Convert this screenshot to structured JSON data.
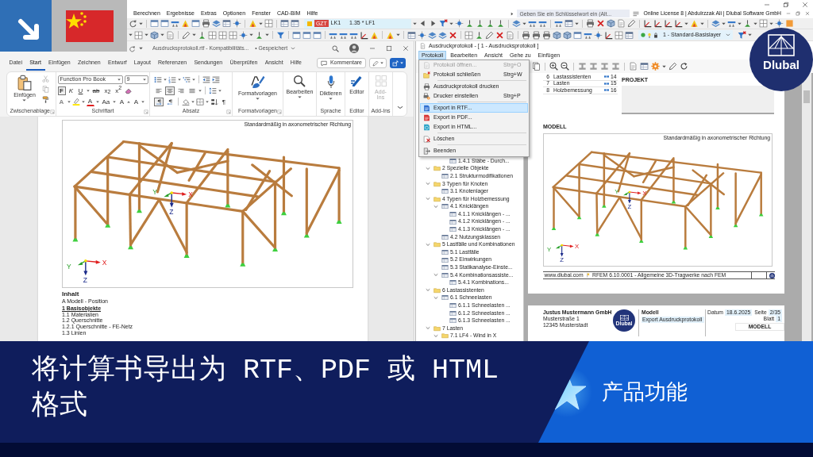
{
  "rfem": {
    "menu": [
      "Berechnen",
      "Ergebnisse",
      "Extras",
      "Optionen",
      "Fenster",
      "CAD-BIM",
      "Hilfe"
    ],
    "search": {
      "placeholder": "Geben Sie ein Schlüsselwort ein (Alt..."
    },
    "license": "Online License 8 | Abdulrzzak Ali | Dlubal Software GmbH",
    "load_combination": {
      "tag": "GZT",
      "name": "LK1",
      "formula": "1.35 * LF1"
    },
    "layer": "1 - Standard-Basislayer"
  },
  "word": {
    "title": "Ausdrucksprotokoll.rtf - Kompatibilitäts...",
    "save_status": "• Gespeichert",
    "tabs": [
      {
        "label": "Datei",
        "selected": false
      },
      {
        "label": "Start",
        "selected": true
      },
      {
        "label": "Einfügen",
        "selected": false
      },
      {
        "label": "Zeichnen",
        "selected": false
      },
      {
        "label": "Entwurf",
        "selected": false
      },
      {
        "label": "Layout",
        "selected": false
      },
      {
        "label": "Referenzen",
        "selected": false
      },
      {
        "label": "Sendungen",
        "selected": false
      },
      {
        "label": "Überprüfen",
        "selected": false
      },
      {
        "label": "Ansicht",
        "selected": false
      },
      {
        "label": "Hilfe",
        "selected": false
      }
    ],
    "comments_button": "Kommentare",
    "ribbon": {
      "groups": [
        {
          "kind": "clipboard",
          "label": "Zwischenablage",
          "button": "Einfügen",
          "disabled": false
        },
        {
          "kind": "font",
          "label": "Schriftart",
          "disabled": false,
          "font": "Function Pro Book",
          "size": "9",
          "format_buttons": [
            {
              "kind": "bold",
              "label": "F",
              "selected": true
            },
            {
              "kind": "italic",
              "label": "K",
              "selected": false
            },
            {
              "kind": "underline",
              "label": "U",
              "selected": false
            },
            {
              "kind": "strike",
              "label": "ab",
              "selected": false
            },
            {
              "kind": "subscript",
              "label": "x$_{2}$",
              "selected": false
            },
            {
              "kind": "superscript",
              "label": "x$^{2}$",
              "selected": false
            }
          ],
          "effect_buttons": [
            {
              "kind": "effects",
              "label": "A"
            },
            {
              "kind": "font-color",
              "label": "A"
            },
            {
              "kind": "case",
              "label": "Aa"
            },
            {
              "kind": "grow",
              "label": "A"
            },
            {
              "kind": "shrink",
              "label": "A"
            }
          ]
        },
        {
          "kind": "paragraph",
          "label": "Absatz",
          "disabled": false,
          "align": [
            {
              "kind": "left",
              "selected": false
            },
            {
              "kind": "center",
              "selected": true
            },
            {
              "kind": "right",
              "selected": false
            },
            {
              "kind": "justify",
              "selected": false
            }
          ],
          "direction": [
            {
              "kind": "ltr",
              "selected": true
            },
            {
              "kind": "rtl",
              "selected": false
            }
          ],
          "marks_button": "¶"
        },
        {
          "kind": "styles",
          "label": "Formatvorlagen",
          "button": "Formatvorlagen",
          "disabled": false
        },
        {
          "kind": "editing",
          "button": "Bearbeiten",
          "disabled": false
        },
        {
          "kind": "dictate",
          "label": "Sprache",
          "button": "Diktieren",
          "disabled": false
        },
        {
          "kind": "editor",
          "label": "Editor",
          "button": "Editor",
          "disabled": false
        },
        {
          "kind": "addins",
          "label": "Add-Ins",
          "button": "Add-Ins",
          "disabled": true
        }
      ]
    },
    "document": {
      "figure": {
        "caption": "Standardmäßig in axonometrischer Richtung",
        "triads": [
          {
            "labels": [
              "X",
              "Y",
              "Z"
            ]
          },
          {
            "labels": [
              "X",
              "Y",
              "Z"
            ]
          }
        ]
      },
      "heading": "Inhalt",
      "lines": [
        {
          "kind": "entry",
          "text": "A Modell - Position"
        },
        {
          "kind": "section",
          "text": "1 Basisobjekte"
        },
        {
          "kind": "entry",
          "text": "1.1 Materialien"
        },
        {
          "kind": "entry",
          "text": "1.2 Querschnitte"
        },
        {
          "kind": "entry",
          "text": "1.2.1 Querschnitte - FE-Netz"
        },
        {
          "kind": "entry",
          "text": "1.3 Linien"
        }
      ]
    }
  },
  "report": {
    "title": "Ausdruckprotokoll - [ 1 - Ausdrucksprotokoll ]",
    "menu": [
      {
        "label": "Protokoll",
        "selected": true
      },
      {
        "label": "Bearbeiten",
        "selected": false
      },
      {
        "label": "Ansicht",
        "selected": false
      },
      {
        "label": "Gehe zu",
        "selected": false
      },
      {
        "label": "Einfügen",
        "selected": false
      }
    ],
    "dropdown": [
      {
        "kind": "open",
        "label": "Protokoll öffnen...",
        "shortcut": "Strg+O",
        "disabled": true,
        "selected": false
      },
      {
        "kind": "close",
        "label": "Protokoll schließen",
        "shortcut": "Strg+W",
        "disabled": false,
        "selected": false
      },
      {
        "kind": "separator"
      },
      {
        "kind": "print",
        "label": "Ausdruckprotokoll drucken",
        "disabled": false,
        "selected": false
      },
      {
        "kind": "setup",
        "label": "Drucker einstellen",
        "shortcut": "Strg+P",
        "disabled": false,
        "selected": false
      },
      {
        "kind": "separator"
      },
      {
        "kind": "rtf",
        "label": "Export in RTF...",
        "disabled": false,
        "selected": true
      },
      {
        "kind": "pdf",
        "label": "Export in PDF...",
        "disabled": false,
        "selected": false
      },
      {
        "kind": "html",
        "label": "Export in HTML...",
        "disabled": false,
        "selected": false
      },
      {
        "kind": "separator"
      },
      {
        "kind": "delete",
        "label": "Löschen",
        "disabled": false,
        "selected": false
      },
      {
        "kind": "separator"
      },
      {
        "kind": "exit",
        "label": "Beenden",
        "disabled": false,
        "selected": false
      }
    ],
    "tree": [
      {
        "children": [
          {
            "children": [
              {
                "label": "1.4.1 Stäbe - Durch...",
                "kind": "table"
              }
            ]
          }
        ]
      },
      {
        "label": "2 Spezielle Objekte",
        "kind": "folder",
        "expanded": true,
        "children": [
          {
            "label": "2.1 Strukturmodifikationen",
            "kind": "table"
          }
        ]
      },
      {
        "label": "3 Typen für Knoten",
        "kind": "folder",
        "expanded": true,
        "children": [
          {
            "label": "3.1 Knotenlager",
            "kind": "table"
          }
        ]
      },
      {
        "label": "4 Typen für Holzbemessung",
        "kind": "folder",
        "expanded": true,
        "children": [
          {
            "label": "4.1 Knicklängen",
            "kind": "table",
            "expanded": true,
            "children": [
              {
                "label": "4.1.1 Knicklängen - ...",
                "kind": "table"
              },
              {
                "label": "4.1.2 Knicklängen - ...",
                "kind": "table"
              },
              {
                "label": "4.1.3 Knicklängen - ...",
                "kind": "table"
              }
            ]
          },
          {
            "label": "4.2 Nutzungsklassen",
            "kind": "table"
          }
        ]
      },
      {
        "label": "5 Lastfälle und Kombinationen",
        "kind": "folder",
        "expanded": true,
        "children": [
          {
            "label": "5.1 Lastfälle",
            "kind": "table"
          },
          {
            "label": "5.2 Einwirkungen",
            "kind": "table"
          },
          {
            "label": "5.3 Statikanalyse-Einste...",
            "kind": "table"
          },
          {
            "label": "5.4 Kombinationsassiste...",
            "kind": "table",
            "expanded": true,
            "children": [
              {
                "label": "5.4.1 Kombinations...",
                "kind": "table"
              }
            ]
          }
        ]
      },
      {
        "label": "6 Lastassistenten",
        "kind": "folder",
        "expanded": true,
        "children": [
          {
            "label": "6.1 Schneelasten",
            "kind": "table",
            "expanded": true,
            "children": [
              {
                "label": "6.1.1 Schneelasten ...",
                "kind": "table"
              },
              {
                "label": "6.1.2 Schneelasten ...",
                "kind": "table"
              },
              {
                "label": "6.1.3 Schneelasten ...",
                "kind": "table"
              }
            ]
          }
        ]
      },
      {
        "label": "7 Lasten",
        "kind": "folder",
        "expanded": true,
        "children": [
          {
            "label": "7.1 LF4 - Wind in X",
            "kind": "folder",
            "expanded": true
          }
        ]
      }
    ],
    "pages": {
      "toc": [
        {
          "number": "6",
          "title": "Lastassistenten",
          "page": "14"
        },
        {
          "number": "7",
          "title": "Lasten",
          "page": "15"
        },
        {
          "number": "8",
          "title": "Holzbemessung",
          "page": "16"
        }
      ],
      "project_heading": "PROJEKT",
      "model_heading": "MODELL",
      "figure": {
        "caption": "Standardmäßig in axonometrischer Richtung",
        "triads": [
          {
            "labels": [
              "X",
              "Y",
              "Z"
            ]
          },
          {
            "labels": [
              "X",
              "Y",
              "Z"
            ]
          }
        ]
      },
      "footer": {
        "website": "www.dlubal.com",
        "software": "RFEM 6.10.0001 - Allgemeine 3D-Tragwerke nach FEM"
      },
      "header": {
        "company": "Justus Mustermann GmbH",
        "street": "Musterstraße 1",
        "city": "12345 Musterstadt",
        "logo": "Dlubal",
        "model_label": "Modell",
        "model_name": "Export Ausdruckprotokoll",
        "fields": [
          {
            "label": "Datum",
            "value": "18.6.2025"
          },
          {
            "label": "Seite",
            "value": "2/35"
          },
          {
            "label": "Blatt",
            "value": "1"
          }
        ],
        "chapter": "MODELL"
      }
    }
  },
  "logo": "Dlubal",
  "banner": {
    "title": "将计算书导出为 RTF、PDF 或 HTML 格式",
    "tag": "产品功能"
  }
}
